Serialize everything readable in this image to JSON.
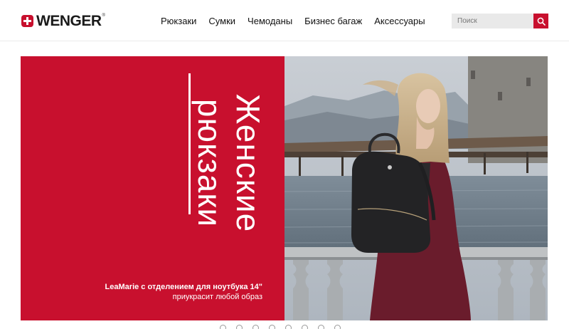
{
  "brand": {
    "logo_text": "WENGER",
    "logo_mark": "®",
    "accent": "#c8102e"
  },
  "nav": {
    "items": [
      {
        "label": "Рюкзаки"
      },
      {
        "label": "Сумки"
      },
      {
        "label": "Чемоданы"
      },
      {
        "label": "Бизнес багаж"
      },
      {
        "label": "Аксессуары"
      }
    ]
  },
  "search": {
    "placeholder": "Поиск",
    "value": "",
    "icon": "search-icon"
  },
  "hero": {
    "headline_line1": "Женские",
    "headline_line2": "рюкзаки",
    "caption_title": "LeaMarie с отделением для ноутбука 14\"",
    "caption_subtitle": "приукрасит любой образ",
    "background_color": "#c8102e"
  },
  "carousel": {
    "slide_count": 8,
    "active_index": 0
  }
}
